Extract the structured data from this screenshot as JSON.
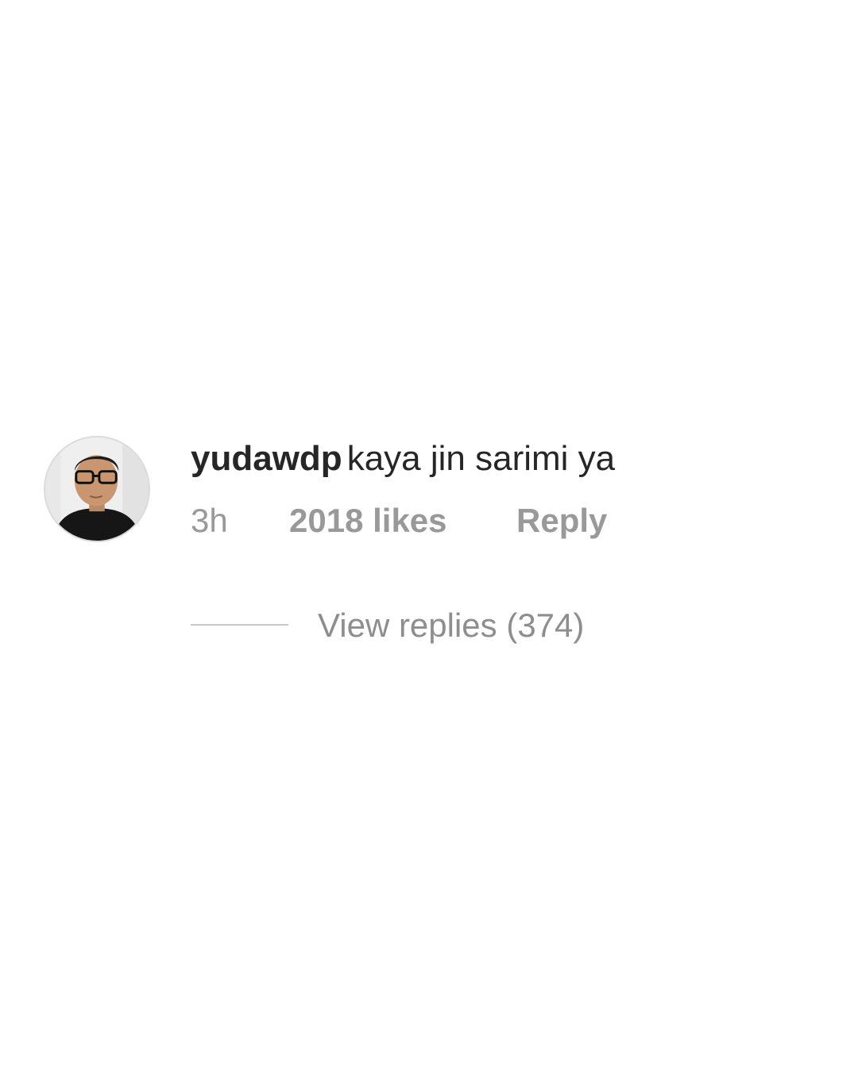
{
  "comment": {
    "avatar_icon": "profile-photo-icon",
    "username": "yudawdp",
    "text": "kaya jin sarimi ya",
    "time": "3h",
    "likes": "2018 likes",
    "reply_label": "Reply",
    "view_replies_label": "View replies (374)"
  },
  "colors": {
    "text_primary": "#262626",
    "text_secondary": "#999999",
    "divider": "#c7c7c7",
    "background": "#ffffff"
  }
}
